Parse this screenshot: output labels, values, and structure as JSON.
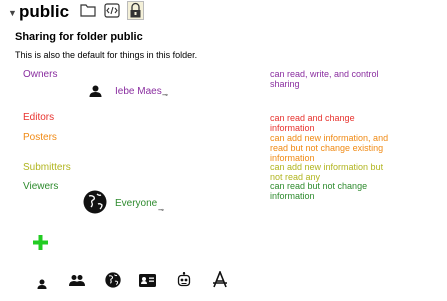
{
  "header": {
    "toggle_icon": "triangle-down",
    "folder_name": "public",
    "toolbar": [
      "folder-icon",
      "source-icon",
      "lock-icon"
    ]
  },
  "sharing": {
    "heading": "Sharing for folder public",
    "subtext": "This is also the default for things in this folder."
  },
  "roles": {
    "owners": {
      "label": "Owners",
      "description": "can read, write, and control sharing",
      "member": "Iebe Maes",
      "color": "#8a2ea0"
    },
    "editors": {
      "label": "Editors",
      "description": "can read and change information",
      "color": "#e8332e"
    },
    "posters": {
      "label": "Posters",
      "description": "can add new information, and read but not change existing information",
      "color": "#f08a14"
    },
    "submitters": {
      "label": "Submitters",
      "description": "can add new information but not read any",
      "color": "#b1b520"
    },
    "viewers": {
      "label": "Viewers",
      "description": "can read but not change information",
      "member": "Everyone",
      "color": "#2e8b2e"
    }
  },
  "add_button": {
    "icon": "plus-icon",
    "color": "#22cc22"
  },
  "footer_icons": [
    "person-icon",
    "group-icon",
    "globe-icon",
    "id-card-icon",
    "robot-icon",
    "app-store-icon"
  ]
}
